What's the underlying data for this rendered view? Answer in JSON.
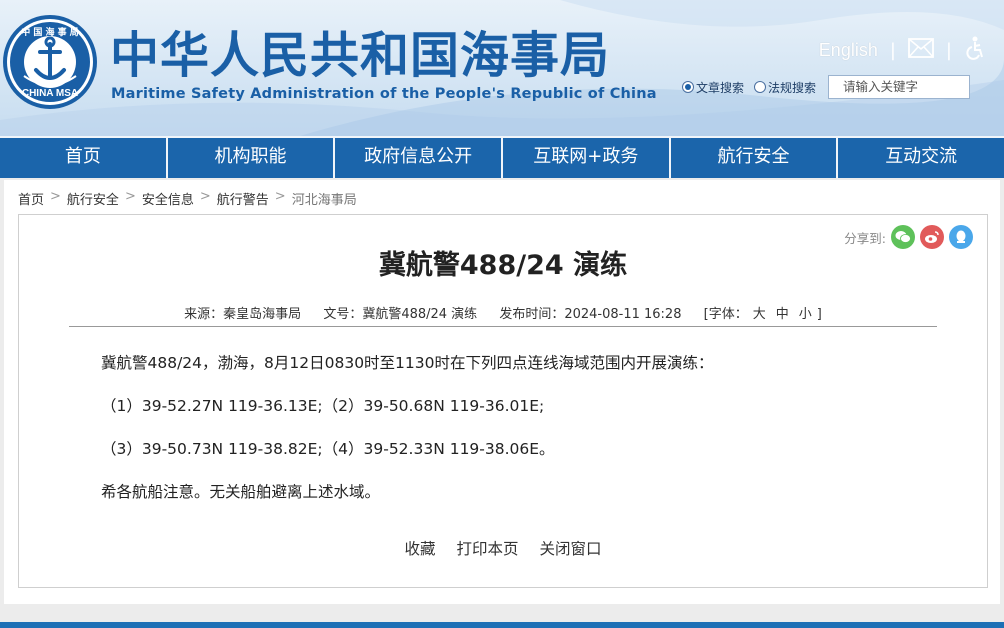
{
  "header": {
    "logo": {
      "top_text": "中 国 海 事 局",
      "bottom_text": "CHINA MSA"
    },
    "title_cn": "中华人民共和国海事局",
    "title_en": "Maritime Safety Administration of the People's Republic of China",
    "english_link": "English",
    "separator": "|",
    "icons": [
      "mail-icon",
      "accessibility-icon"
    ],
    "search": {
      "options": [
        {
          "label": "文章搜索",
          "selected": true
        },
        {
          "label": "法规搜索",
          "selected": false
        }
      ],
      "placeholder": "请输入关键字"
    }
  },
  "nav": {
    "items": [
      "首页",
      "机构职能",
      "政府信息公开",
      "互联网+政务",
      "航行安全",
      "互动交流"
    ]
  },
  "breadcrumb": {
    "items": [
      "首页",
      "航行安全",
      "安全信息",
      "航行警告",
      "河北海事局"
    ],
    "separator": ">"
  },
  "share": {
    "label": "分享到:",
    "targets": [
      {
        "icon": "wechat-icon",
        "color": "#5ec15a"
      },
      {
        "icon": "weibo-icon",
        "color": "#e15a5a"
      },
      {
        "icon": "qq-icon",
        "color": "#4aa7ea"
      }
    ]
  },
  "article": {
    "title": "冀航警488/24 演练",
    "meta": {
      "source": "来源：秦皇岛海事局",
      "doc_no": "文号：冀航警488/24 演练",
      "published": "发布时间：2024-08-11 16:28",
      "font_label": "[字体：",
      "font_sizes": [
        "大",
        "中",
        "小"
      ],
      "font_close": "]"
    },
    "paragraphs": [
      "冀航警488/24，渤海，8月12日0830时至1130时在下列四点连线海域范围内开展演练：",
      "（1）39-52.27N 119-36.13E;（2）39-50.68N 119-36.01E;",
      "（3）39-50.73N 119-38.82E;（4）39-52.33N 119-38.06E。",
      "希各航船注意。无关船舶避离上述水域。"
    ],
    "actions": [
      "收藏",
      "打印本页",
      "关闭窗口"
    ]
  },
  "colors": {
    "brand_blue": "#1a5fa6",
    "nav_blue": "#1b65ab"
  }
}
